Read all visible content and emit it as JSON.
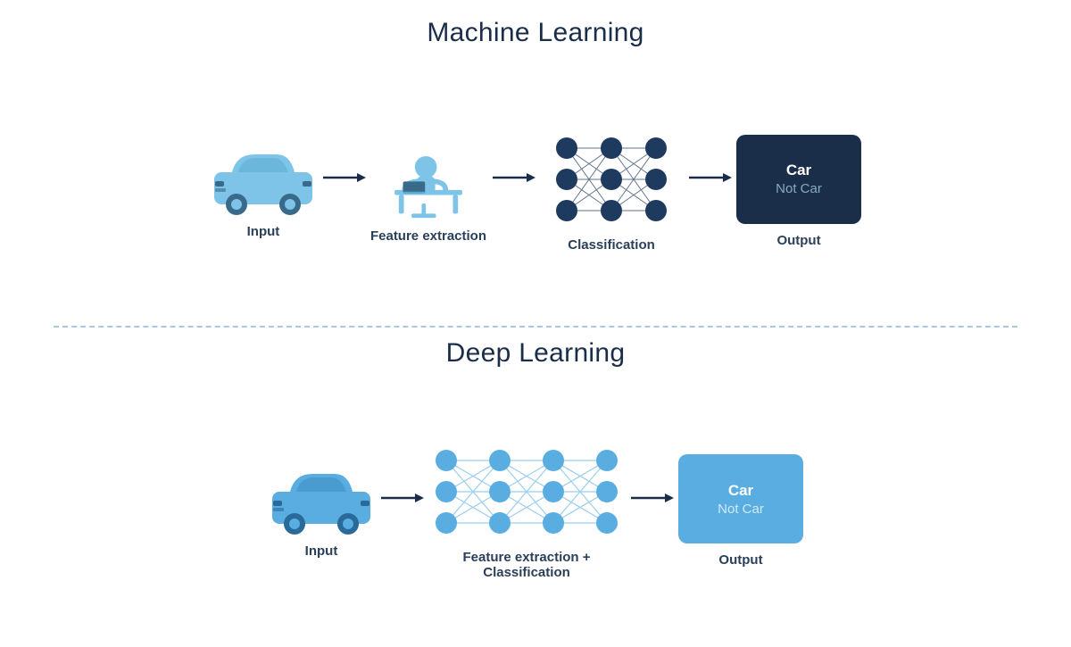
{
  "ml": {
    "title": "Machine Learning",
    "steps": [
      {
        "label": "Input"
      },
      {
        "label": "Feature extraction"
      },
      {
        "label": "Classification"
      },
      {
        "label": "Output"
      }
    ],
    "output": {
      "car": "Car",
      "notcar": "Not Car"
    }
  },
  "dl": {
    "title": "Deep Learning",
    "steps": [
      {
        "label": "Input"
      },
      {
        "label": "Feature extraction + Classification"
      },
      {
        "label": "Output"
      }
    ],
    "output": {
      "car": "Car",
      "notcar": "Not Car"
    }
  },
  "colors": {
    "light_blue": "#7dc4e8",
    "dark_blue": "#1a2e4a",
    "arrow": "#1a2e4a",
    "node_dark": "#1e3a5f",
    "node_light": "#5aade0",
    "car_body": "#7dc4e8",
    "person": "#7dc4e8"
  }
}
